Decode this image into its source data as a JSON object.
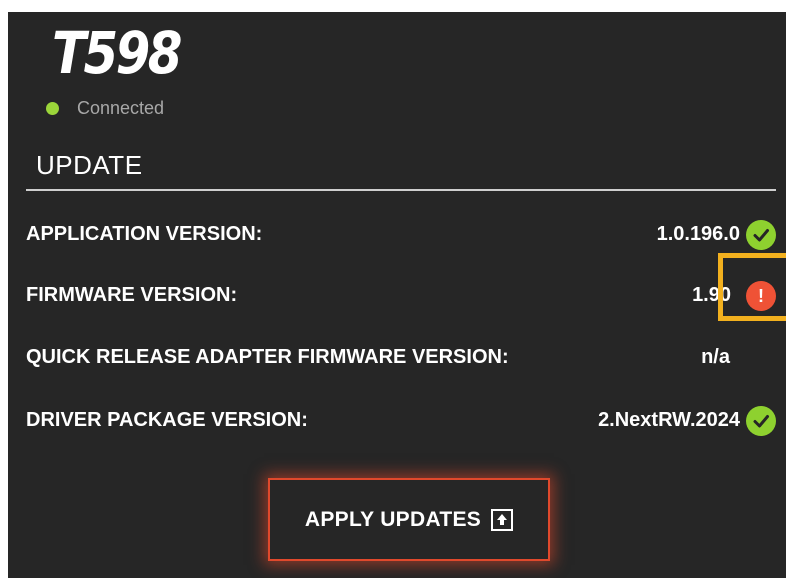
{
  "device": {
    "name": "T598",
    "status_text": "Connected",
    "status_color": "#9bd53a"
  },
  "section": {
    "title": "UPDATE"
  },
  "rows": [
    {
      "label": "APPLICATION VERSION:",
      "value": "1.0.196.0",
      "status": "ok",
      "icon": "checkmark-circle-icon"
    },
    {
      "label": "FIRMWARE VERSION:",
      "value": "1.90",
      "status": "warning",
      "icon": "exclamation-circle-icon"
    },
    {
      "label": "QUICK RELEASE ADAPTER FIRMWARE VERSION:",
      "value": "n/a",
      "status": "none",
      "icon": ""
    },
    {
      "label": "DRIVER PACKAGE VERSION:",
      "value": "2.NextRW.2024",
      "status": "ok",
      "icon": "checkmark-circle-icon"
    }
  ],
  "warning_mark": "!",
  "apply_button": {
    "label": "APPLY UPDATES",
    "icon": "upload-icon"
  },
  "colors": {
    "background": "#262626",
    "ok": "#8ed12f",
    "warning": "#ef5236",
    "highlight": "#f2b01e",
    "button_border": "#e0492c"
  }
}
